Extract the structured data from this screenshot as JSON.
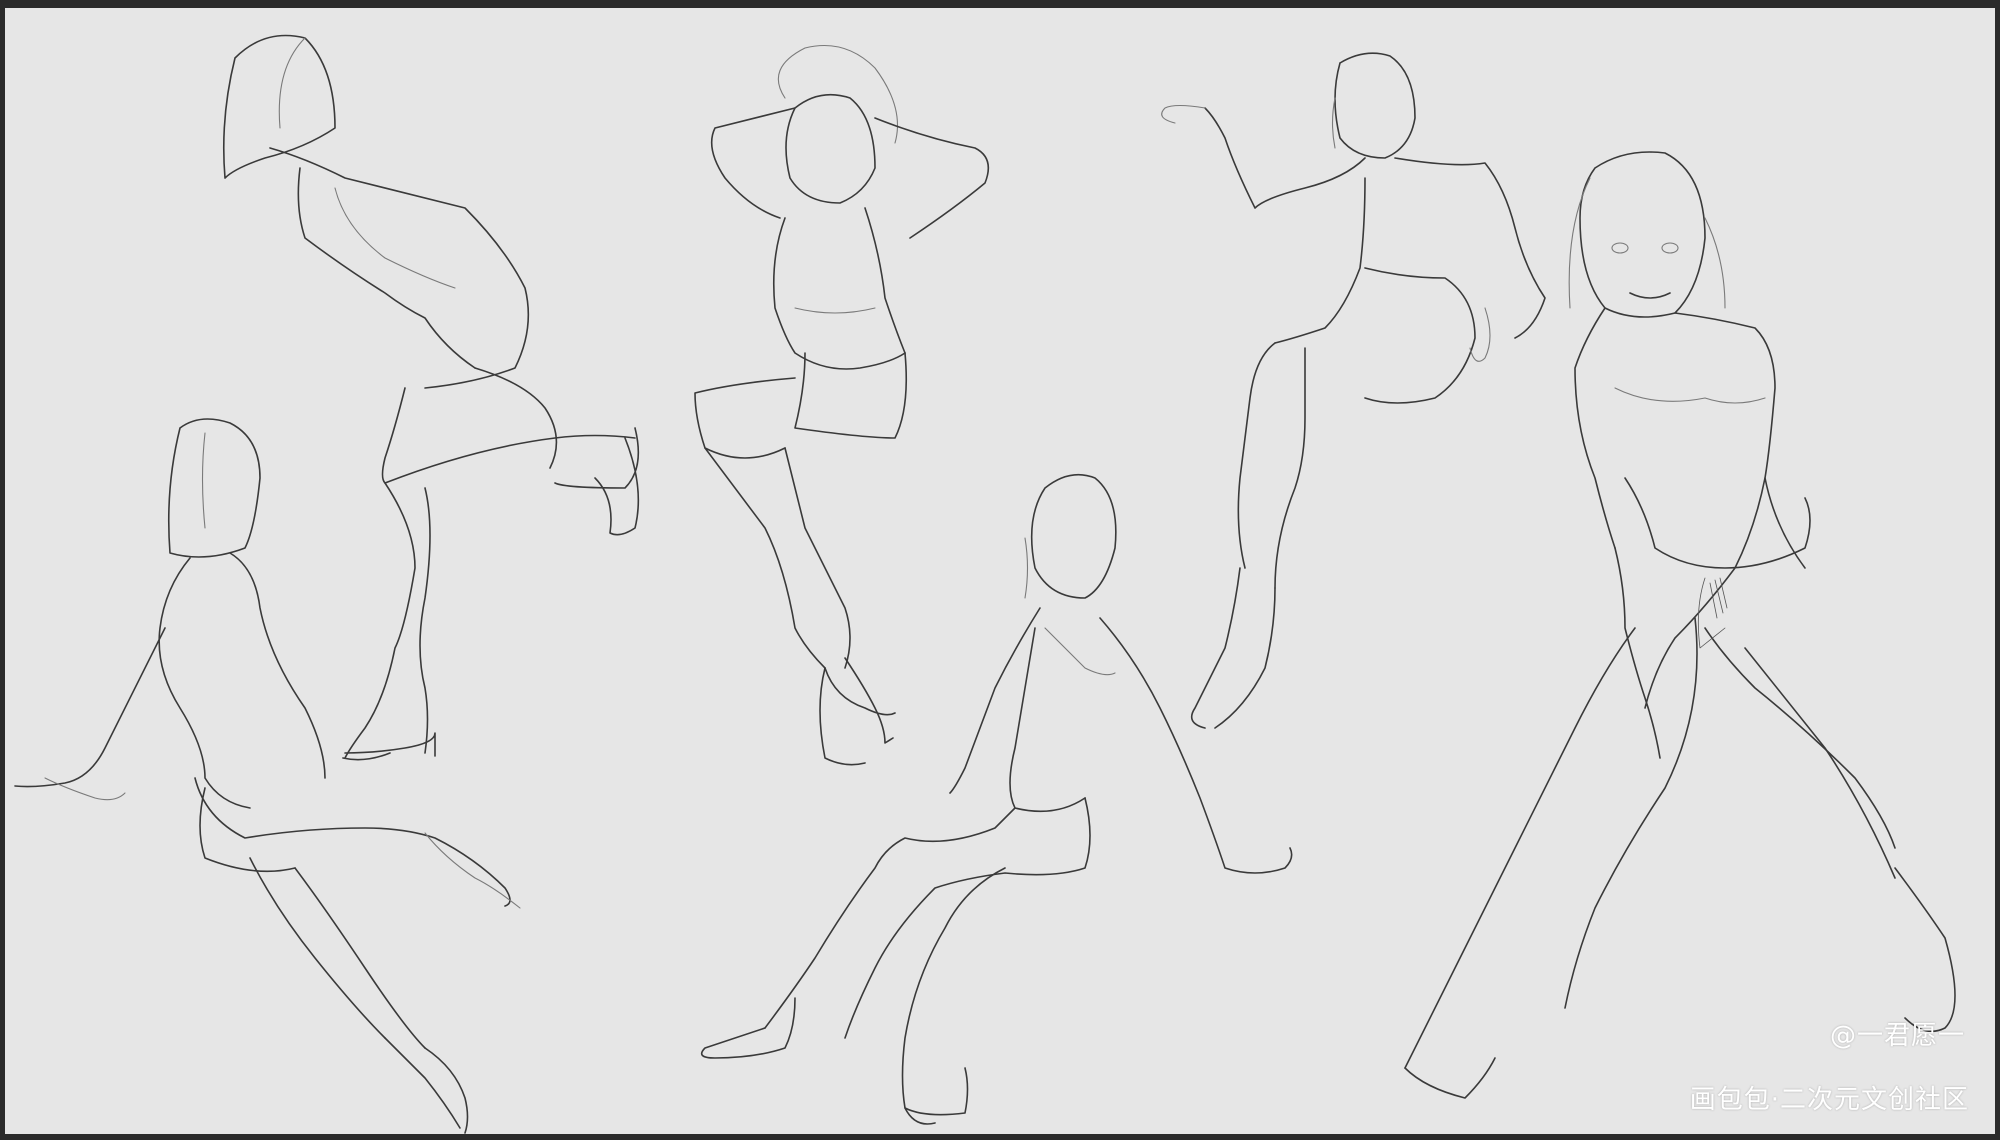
{
  "artwork": {
    "subject": "figure-gesture-sketches",
    "background_color": "#e6e6e6",
    "frame_color": "#2b2b2b",
    "line_color": "#3a3a3a",
    "figure_count": 6
  },
  "watermark": {
    "handle": "@一君愿一",
    "site": "画包包·二次元文创社区"
  }
}
